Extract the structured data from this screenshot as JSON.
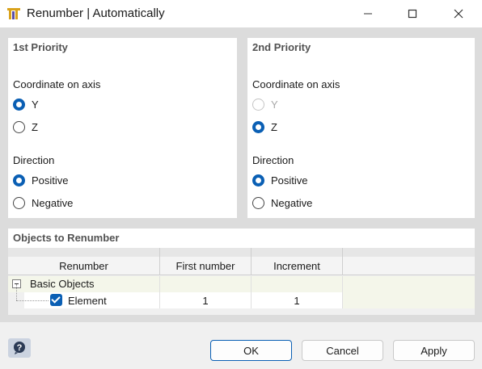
{
  "window": {
    "title": "Renumber | Automatically"
  },
  "priority1": {
    "header": "1st Priority",
    "coordinate_label": "Coordinate on axis",
    "coordinate_options": [
      "Y",
      "Z"
    ],
    "direction_label": "Direction",
    "direction_options": [
      "Positive",
      "Negative"
    ],
    "selected_coordinate": "Y",
    "selected_direction": "Positive"
  },
  "priority2": {
    "header": "2nd Priority",
    "coordinate_label": "Coordinate on axis",
    "coordinate_options": [
      "Y",
      "Z"
    ],
    "direction_label": "Direction",
    "direction_options": [
      "Positive",
      "Negative"
    ],
    "selected_coordinate": "Z",
    "selected_direction": "Positive",
    "disabled_options": [
      "Y"
    ]
  },
  "objects": {
    "header": "Objects to Renumber",
    "columns": [
      "Renumber",
      "First number",
      "Increment"
    ],
    "group_label": "Basic Objects",
    "rows": [
      {
        "label": "Element",
        "checked": true,
        "first_number": "1",
        "increment": "1"
      }
    ]
  },
  "footer": {
    "ok": "OK",
    "cancel": "Cancel",
    "apply": "Apply"
  },
  "colors": {
    "accent": "#0a5fb4",
    "panel_bg": "#dcdcdc",
    "row_tint": "#f4f6ea"
  },
  "icons": [
    "app-icon",
    "minimize-icon",
    "maximize-icon",
    "close-icon",
    "help-icon",
    "collapse-icon",
    "checkbox-checked-icon"
  ]
}
